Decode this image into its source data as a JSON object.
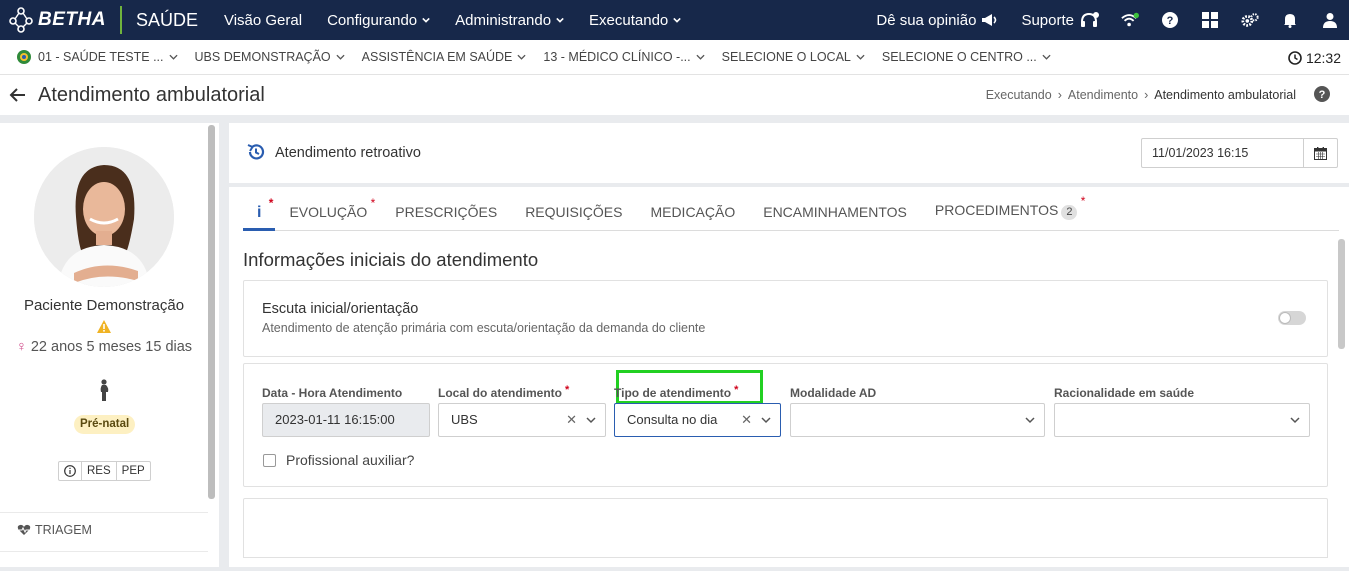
{
  "topnav": {
    "logo_text": "BETHA",
    "app_name": "SAÚDE",
    "menu": [
      {
        "label": "Visão Geral"
      },
      {
        "label": "Configurando"
      },
      {
        "label": "Administrando"
      },
      {
        "label": "Executando"
      }
    ],
    "feedback_label": "Dê sua opinião",
    "support_label": "Suporte",
    "icons": [
      "megaphone-icon",
      "headset-icon",
      "wifi-icon",
      "help-icon",
      "grid-apps-icon",
      "gears-icon",
      "bell-icon",
      "user-icon"
    ],
    "wifi_status_color": "#3ec33e"
  },
  "context": {
    "items": [
      {
        "label": "01 - SAÚDE TESTE ...",
        "icon": "brasao-icon"
      },
      {
        "label": "UBS DEMONSTRAÇÃO"
      },
      {
        "label": "ASSISTÊNCIA EM SAÚDE"
      },
      {
        "label": "13 - MÉDICO CLÍNICO -..."
      },
      {
        "label": "SELECIONE O LOCAL"
      },
      {
        "label": "SELECIONE O CENTRO ..."
      }
    ],
    "time": "12:32"
  },
  "page": {
    "title": "Atendimento ambulatorial",
    "breadcrumb": [
      "Executando",
      "Atendimento",
      "Atendimento ambulatorial"
    ]
  },
  "patient": {
    "name": "Paciente Demonstração",
    "age": "22 anos 5 meses 15 dias",
    "badge": "Pré-natal",
    "buttons": [
      "RES",
      "PEP"
    ],
    "triage_label": "TRIAGEM"
  },
  "retro": {
    "label": "Atendimento retroativo",
    "datetime": "11/01/2023 16:15"
  },
  "tabs": [
    {
      "label": "i",
      "required": true,
      "active": true
    },
    {
      "label": "EVOLUÇÃO",
      "required": true
    },
    {
      "label": "PRESCRIÇÕES"
    },
    {
      "label": "REQUISIÇÕES"
    },
    {
      "label": "MEDICAÇÃO"
    },
    {
      "label": "ENCAMINHAMENTOS"
    },
    {
      "label": "PROCEDIMENTOS",
      "count": "2",
      "required": true
    }
  ],
  "section": {
    "title": "Informações iniciais do atendimento"
  },
  "escuta": {
    "title": "Escuta inicial/orientação",
    "description": "Atendimento de atenção primária com escuta/orientação da demanda do cliente",
    "enabled": false
  },
  "form": {
    "data_hora": {
      "label": "Data - Hora Atendimento",
      "value": "2023-01-11 16:15:00"
    },
    "local": {
      "label": "Local do atendimento",
      "value": "UBS",
      "required": true
    },
    "tipo": {
      "label": "Tipo de atendimento",
      "value": "Consulta no dia",
      "required": true
    },
    "modalidade": {
      "label": "Modalidade AD",
      "value": ""
    },
    "racionalidade": {
      "label": "Racionalidade em saúde",
      "value": ""
    },
    "profissional_auxiliar": {
      "label": "Profissional auxiliar?",
      "checked": false
    }
  },
  "colors": {
    "navbar": "#17284a",
    "accent": "#2a5db0",
    "required": "#d0021b",
    "highlight": "#22d022",
    "logo_separator": "#6fb33d"
  }
}
